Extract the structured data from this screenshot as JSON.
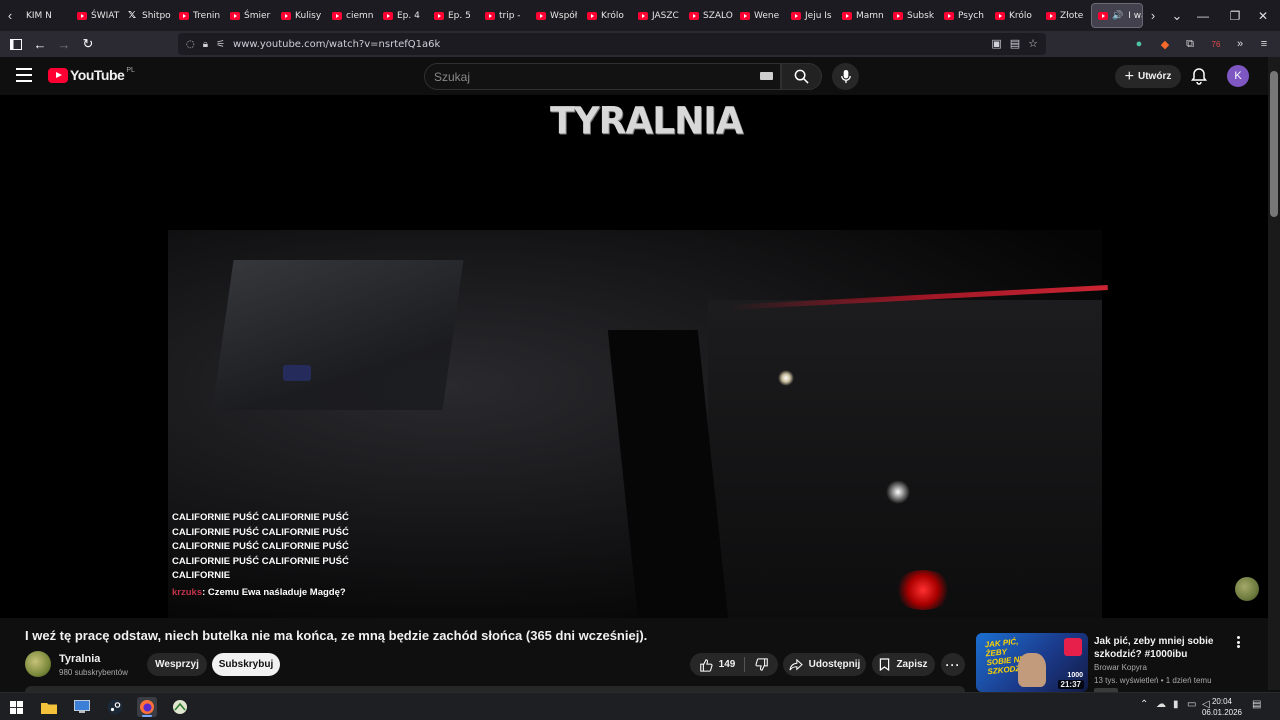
{
  "browser": {
    "tabs": [
      {
        "label": "KIM N",
        "icon": "none"
      },
      {
        "label": "ŚWIAT",
        "icon": "youtube-icon"
      },
      {
        "label": "Shitpo",
        "icon": "x-icon"
      },
      {
        "label": "Trenin",
        "icon": "youtube-icon"
      },
      {
        "label": "Śmier",
        "icon": "youtube-icon"
      },
      {
        "label": "Kulisy",
        "icon": "youtube-icon"
      },
      {
        "label": "ciemn",
        "icon": "youtube-icon"
      },
      {
        "label": "Ep. 4",
        "icon": "youtube-icon"
      },
      {
        "label": "Ep. 5",
        "icon": "youtube-icon"
      },
      {
        "label": "trip -",
        "icon": "youtube-icon"
      },
      {
        "label": "Współ",
        "icon": "youtube-icon"
      },
      {
        "label": "Królo",
        "icon": "youtube-icon"
      },
      {
        "label": "JASZC",
        "icon": "youtube-icon"
      },
      {
        "label": "SZALO",
        "icon": "youtube-icon"
      },
      {
        "label": "Wene",
        "icon": "youtube-icon"
      },
      {
        "label": "Jeju Is",
        "icon": "youtube-icon"
      },
      {
        "label": "Mamn",
        "icon": "youtube-icon"
      },
      {
        "label": "Subsk",
        "icon": "youtube-icon"
      },
      {
        "label": "Psych",
        "icon": "youtube-icon"
      },
      {
        "label": "Królo",
        "icon": "youtube-icon"
      },
      {
        "label": "Złote",
        "icon": "youtube-icon"
      }
    ],
    "active_tab": {
      "label": "I wa"
    },
    "url": "www.youtube.com/watch?v=nsrtefQ1a6k",
    "ext_badge": "76"
  },
  "youtube": {
    "logo_text": "YouTube",
    "country_code": "PL",
    "search_placeholder": "Szukaj",
    "create_label": "Utwórz",
    "account_initial": "K"
  },
  "player": {
    "channel_watermark": "TYRALNIA",
    "chat_lines": [
      "CALIFORNIE PUŚĆ CALIFORNIE PUŚĆ",
      "CALIFORNIE PUŚĆ CALIFORNIE PUŚĆ",
      "CALIFORNIE PUŚĆ CALIFORNIE PUŚĆ",
      "CALIFORNIE PUŚĆ CALIFORNIE PUŚĆ",
      "CALIFORNIE"
    ],
    "chat_user": "krzuks",
    "chat_message": ": Czemu Ewa naśladuje Magdę?"
  },
  "video": {
    "title": "I weź tę pracę odstaw, niech butelka nie ma końca, ze mną będzie zachód słońca (365 dni wcześniej).",
    "channel_name": "Tyralnia",
    "subscribers": "980 subskrybentów",
    "support_label": "Wesprzyj",
    "subscribe_label": "Subskrybuj",
    "likes": "149",
    "share_label": "Udostępnij",
    "save_label": "Zapisz"
  },
  "recommended": {
    "title": "Jak pić, zeby mniej sobie szkodzić? #1000ibu",
    "channel": "Browar Kopyra",
    "meta": "13 tys. wyświetleń • 1 dzień temu",
    "duration": "21:37",
    "thumb_text": "JAK PIĆ, ŻEBY SOBIE NIE SZKODZIĆ?",
    "thumb_count": "1000"
  },
  "taskbar": {
    "time": "20:04",
    "date": "06.01.2026"
  },
  "colors": {
    "yt_red": "#ff0033",
    "page_bg": "#0f0f0f",
    "accent_purple": "#7e57c2"
  }
}
